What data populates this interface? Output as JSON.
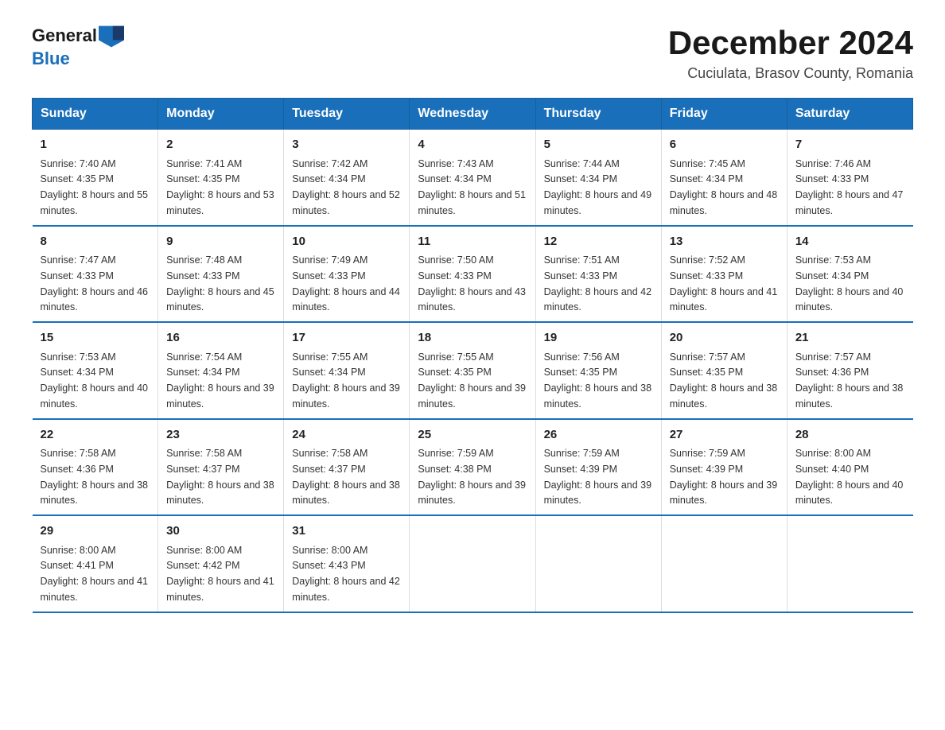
{
  "header": {
    "logo_line1": "General",
    "logo_line2": "Blue",
    "month_year": "December 2024",
    "location": "Cuciulata, Brasov County, Romania"
  },
  "days_of_week": [
    "Sunday",
    "Monday",
    "Tuesday",
    "Wednesday",
    "Thursday",
    "Friday",
    "Saturday"
  ],
  "weeks": [
    [
      {
        "day": "1",
        "sunrise": "7:40 AM",
        "sunset": "4:35 PM",
        "daylight": "8 hours and 55 minutes."
      },
      {
        "day": "2",
        "sunrise": "7:41 AM",
        "sunset": "4:35 PM",
        "daylight": "8 hours and 53 minutes."
      },
      {
        "day": "3",
        "sunrise": "7:42 AM",
        "sunset": "4:34 PM",
        "daylight": "8 hours and 52 minutes."
      },
      {
        "day": "4",
        "sunrise": "7:43 AM",
        "sunset": "4:34 PM",
        "daylight": "8 hours and 51 minutes."
      },
      {
        "day": "5",
        "sunrise": "7:44 AM",
        "sunset": "4:34 PM",
        "daylight": "8 hours and 49 minutes."
      },
      {
        "day": "6",
        "sunrise": "7:45 AM",
        "sunset": "4:34 PM",
        "daylight": "8 hours and 48 minutes."
      },
      {
        "day": "7",
        "sunrise": "7:46 AM",
        "sunset": "4:33 PM",
        "daylight": "8 hours and 47 minutes."
      }
    ],
    [
      {
        "day": "8",
        "sunrise": "7:47 AM",
        "sunset": "4:33 PM",
        "daylight": "8 hours and 46 minutes."
      },
      {
        "day": "9",
        "sunrise": "7:48 AM",
        "sunset": "4:33 PM",
        "daylight": "8 hours and 45 minutes."
      },
      {
        "day": "10",
        "sunrise": "7:49 AM",
        "sunset": "4:33 PM",
        "daylight": "8 hours and 44 minutes."
      },
      {
        "day": "11",
        "sunrise": "7:50 AM",
        "sunset": "4:33 PM",
        "daylight": "8 hours and 43 minutes."
      },
      {
        "day": "12",
        "sunrise": "7:51 AM",
        "sunset": "4:33 PM",
        "daylight": "8 hours and 42 minutes."
      },
      {
        "day": "13",
        "sunrise": "7:52 AM",
        "sunset": "4:33 PM",
        "daylight": "8 hours and 41 minutes."
      },
      {
        "day": "14",
        "sunrise": "7:53 AM",
        "sunset": "4:34 PM",
        "daylight": "8 hours and 40 minutes."
      }
    ],
    [
      {
        "day": "15",
        "sunrise": "7:53 AM",
        "sunset": "4:34 PM",
        "daylight": "8 hours and 40 minutes."
      },
      {
        "day": "16",
        "sunrise": "7:54 AM",
        "sunset": "4:34 PM",
        "daylight": "8 hours and 39 minutes."
      },
      {
        "day": "17",
        "sunrise": "7:55 AM",
        "sunset": "4:34 PM",
        "daylight": "8 hours and 39 minutes."
      },
      {
        "day": "18",
        "sunrise": "7:55 AM",
        "sunset": "4:35 PM",
        "daylight": "8 hours and 39 minutes."
      },
      {
        "day": "19",
        "sunrise": "7:56 AM",
        "sunset": "4:35 PM",
        "daylight": "8 hours and 38 minutes."
      },
      {
        "day": "20",
        "sunrise": "7:57 AM",
        "sunset": "4:35 PM",
        "daylight": "8 hours and 38 minutes."
      },
      {
        "day": "21",
        "sunrise": "7:57 AM",
        "sunset": "4:36 PM",
        "daylight": "8 hours and 38 minutes."
      }
    ],
    [
      {
        "day": "22",
        "sunrise": "7:58 AM",
        "sunset": "4:36 PM",
        "daylight": "8 hours and 38 minutes."
      },
      {
        "day": "23",
        "sunrise": "7:58 AM",
        "sunset": "4:37 PM",
        "daylight": "8 hours and 38 minutes."
      },
      {
        "day": "24",
        "sunrise": "7:58 AM",
        "sunset": "4:37 PM",
        "daylight": "8 hours and 38 minutes."
      },
      {
        "day": "25",
        "sunrise": "7:59 AM",
        "sunset": "4:38 PM",
        "daylight": "8 hours and 39 minutes."
      },
      {
        "day": "26",
        "sunrise": "7:59 AM",
        "sunset": "4:39 PM",
        "daylight": "8 hours and 39 minutes."
      },
      {
        "day": "27",
        "sunrise": "7:59 AM",
        "sunset": "4:39 PM",
        "daylight": "8 hours and 39 minutes."
      },
      {
        "day": "28",
        "sunrise": "8:00 AM",
        "sunset": "4:40 PM",
        "daylight": "8 hours and 40 minutes."
      }
    ],
    [
      {
        "day": "29",
        "sunrise": "8:00 AM",
        "sunset": "4:41 PM",
        "daylight": "8 hours and 41 minutes."
      },
      {
        "day": "30",
        "sunrise": "8:00 AM",
        "sunset": "4:42 PM",
        "daylight": "8 hours and 41 minutes."
      },
      {
        "day": "31",
        "sunrise": "8:00 AM",
        "sunset": "4:43 PM",
        "daylight": "8 hours and 42 minutes."
      },
      {
        "day": "",
        "sunrise": "",
        "sunset": "",
        "daylight": ""
      },
      {
        "day": "",
        "sunrise": "",
        "sunset": "",
        "daylight": ""
      },
      {
        "day": "",
        "sunrise": "",
        "sunset": "",
        "daylight": ""
      },
      {
        "day": "",
        "sunrise": "",
        "sunset": "",
        "daylight": ""
      }
    ]
  ],
  "labels": {
    "sunrise_prefix": "Sunrise: ",
    "sunset_prefix": "Sunset: ",
    "daylight_prefix": "Daylight: "
  }
}
